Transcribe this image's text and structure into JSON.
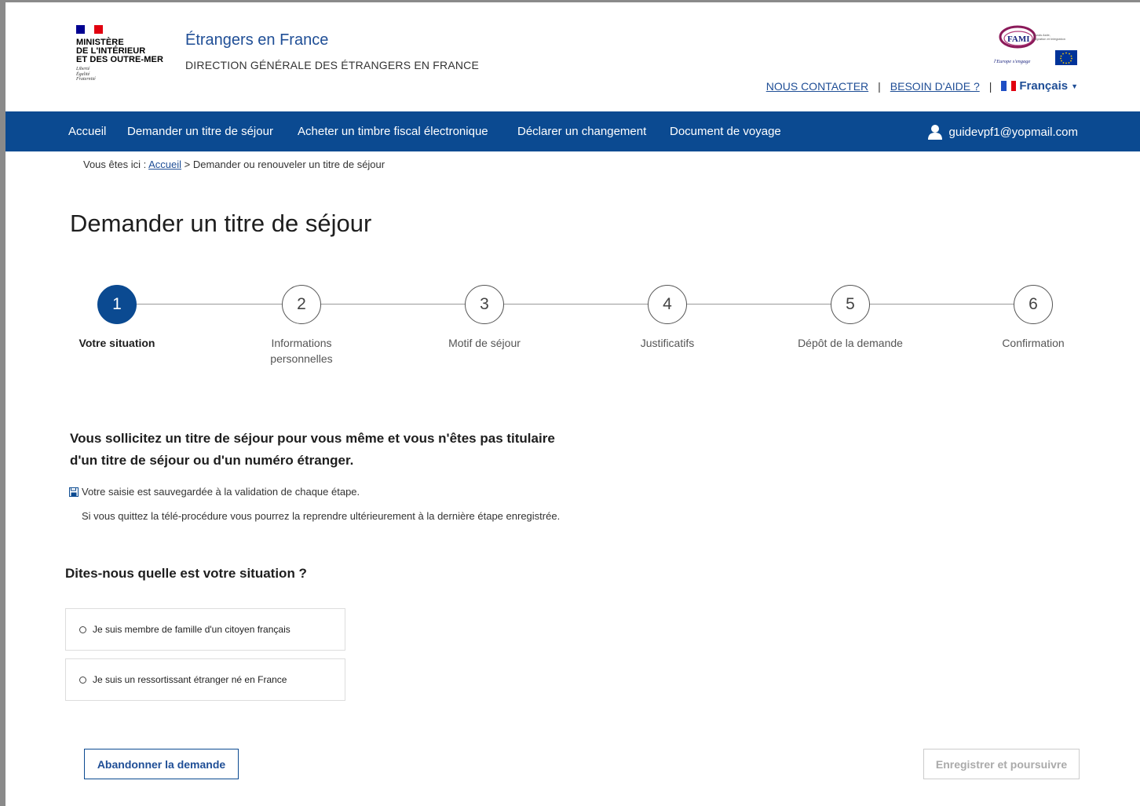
{
  "logo": {
    "title_lines": [
      "MINISTÈRE",
      "DE L'INTÉRIEUR",
      "ET DES OUTRE-MER"
    ],
    "motto_lines": [
      "Liberté",
      "Égalité",
      "Fraternité"
    ],
    "flag_colors": [
      "#000091",
      "#ffffff",
      "#e1000f"
    ]
  },
  "header": {
    "site_title": "Étrangers en France",
    "site_subtitle": "DIRECTION GÉNÉRALE DES ÉTRANGERS EN FRANCE",
    "fami_logo_text": "FAMI",
    "fami_tagline": "Fonds Asile, Migration et Intégration",
    "eu_motto": "l'Europe s'engage",
    "contact_link": "NOUS CONTACTER",
    "help_link": "BESOIN D'AIDE ?",
    "separator": "|",
    "language": "Français"
  },
  "nav": {
    "items": [
      "Accueil",
      "Demander un titre de séjour",
      "Acheter un timbre fiscal électronique",
      "Déclarer un changement",
      "Document de voyage"
    ],
    "user_email": "guidevpf1@yopmail.com"
  },
  "breadcrumb": {
    "prefix": "Vous êtes ici : ",
    "home": "Accueil",
    "current": " > Demander ou renouveler un titre de séjour"
  },
  "page_title": "Demander un titre de séjour",
  "stepper": {
    "active_index": 0,
    "steps": [
      {
        "number": "1",
        "label": "Votre situation"
      },
      {
        "number": "2",
        "label": "Informations personnelles"
      },
      {
        "number": "3",
        "label": "Motif de séjour"
      },
      {
        "number": "4",
        "label": "Justificatifs"
      },
      {
        "number": "5",
        "label": "Dépôt de la demande"
      },
      {
        "number": "6",
        "label": "Confirmation"
      }
    ]
  },
  "intro": "Vous sollicitez un titre de séjour pour vous même et vous n'êtes pas titulaire d'un titre de séjour ou d'un numéro étranger.",
  "save_note": "Votre saisie est sauvegardée à la validation de chaque étape.",
  "resume_note": "Si vous quittez la télé-procédure vous pourrez la reprendre ultérieurement à la dernière étape enregistrée.",
  "question": "Dites-nous quelle est votre situation ?",
  "options": [
    "Je suis membre de famille d'un citoyen français",
    "Je suis un ressortissant étranger né en France"
  ],
  "buttons": {
    "abandon": "Abandonner la demande",
    "continue": "Enregistrer et poursuivre"
  },
  "colors": {
    "primary": "#0b4a91",
    "link": "#1f4e96"
  }
}
